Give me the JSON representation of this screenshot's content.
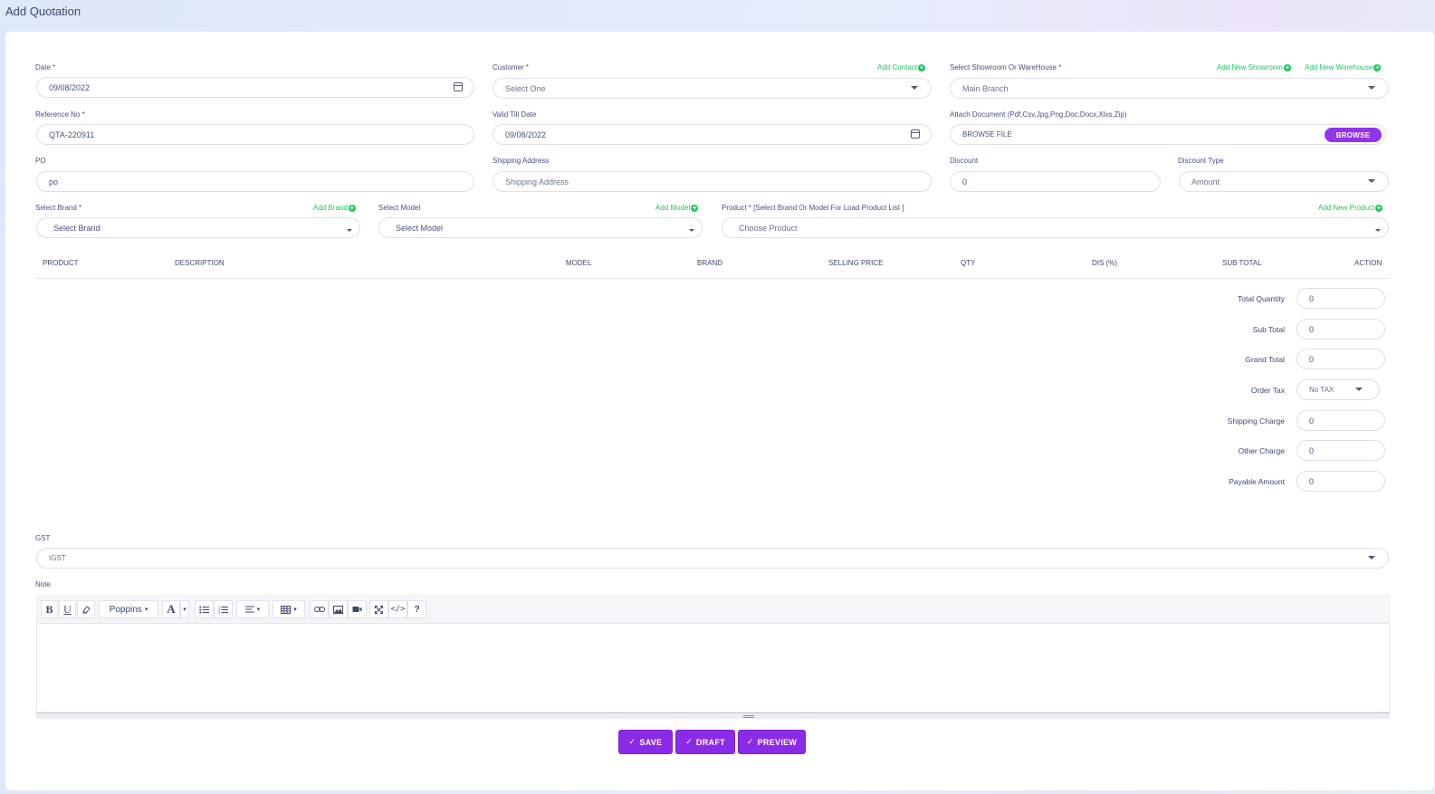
{
  "page": {
    "title": "Add Quotation"
  },
  "form": {
    "date": {
      "label": "Date *",
      "value": "09/08/2022"
    },
    "customer": {
      "label": "Customer *",
      "add_link": "Add Contact",
      "value": "Select One"
    },
    "showroom": {
      "label": "Select Showroom Or WareHouse *",
      "add_showroom": "Add New Showroom",
      "add_warehouse": "Add New Warehouse",
      "value": "Main Branch"
    },
    "reference": {
      "label": "Reference No *",
      "value": "QTA-220911"
    },
    "valid_till": {
      "label": "Valid Till Date",
      "value": "09/08/2022"
    },
    "attach": {
      "label": "Attach Document (Pdf,Csv,Jpg,Png,Doc,Docx,Xlxs,Zip)",
      "value": "BROWSE FILE",
      "button": "BROWSE"
    },
    "po": {
      "label": "PO",
      "value": "po"
    },
    "shipping_address": {
      "label": "Shipping Address",
      "placeholder": "Shipping Address"
    },
    "discount": {
      "label": "Discount",
      "value": "0"
    },
    "discount_type": {
      "label": "Discount Type",
      "value": "Amount"
    },
    "brand": {
      "label": "Select Brand *",
      "add_link": "Add Brand",
      "value": "Select Brand"
    },
    "model": {
      "label": "Select Model",
      "add_link": "Add Model",
      "value": "Select Model"
    },
    "product": {
      "label": "Product * [Select Brand Or Model For Load Product List ]",
      "add_link": "Add New Product",
      "value": "Choose Product"
    }
  },
  "table": {
    "columns": [
      "PRODUCT",
      "DESCRIPTION",
      "MODEL",
      "BRAND",
      "SELLING PRICE",
      "QTY",
      "DIS (%)",
      "SUB TOTAL",
      "ACTION"
    ]
  },
  "summary": {
    "total_quantity": {
      "label": "Total Quantity",
      "value": "0"
    },
    "sub_total": {
      "label": "Sub Total",
      "value": "0"
    },
    "grand_total": {
      "label": "Grand Total",
      "value": "0"
    },
    "order_tax": {
      "label": "Order Tax",
      "value": "No TAX"
    },
    "shipping_charge": {
      "label": "Shipping Charge",
      "value": "0"
    },
    "other_charge": {
      "label": "Other Charge",
      "value": "0"
    },
    "payable_amount": {
      "label": "Payable Amount",
      "value": "0"
    }
  },
  "gst": {
    "label": "GST",
    "value": "IGST"
  },
  "note": {
    "label": "Note",
    "toolbar": {
      "font": "Poppins"
    }
  },
  "actions": {
    "save": "SAVE",
    "draft": "DRAFT",
    "preview": "PREVIEW"
  }
}
